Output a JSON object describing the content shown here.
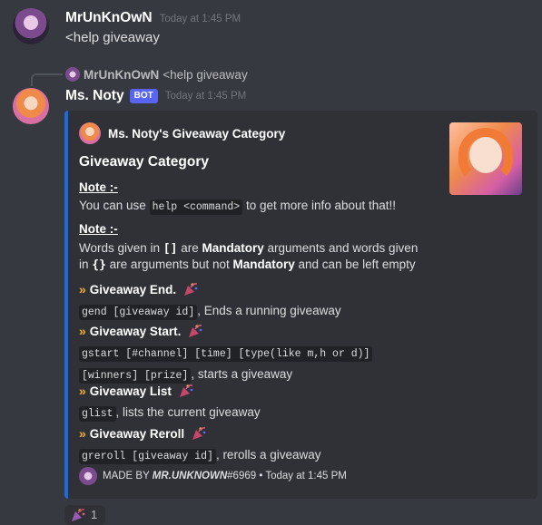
{
  "messages": [
    {
      "username": "MrUnKnOwN",
      "timestamp": "Today at 1:45 PM",
      "content": "<help giveaway"
    },
    {
      "reply": {
        "username": "MrUnKnOwN",
        "content": "<help giveaway"
      },
      "username": "Ms. Noty",
      "bot_tag": "BOT",
      "timestamp": "Today at 1:45 PM"
    }
  ],
  "embed": {
    "accent_color": "#1d6be0",
    "author": "Ms. Noty's Giveaway Category",
    "title": "Giveaway Category",
    "note1": {
      "heading": "Note :-",
      "text_before": "You can use ",
      "code": "help <command>",
      "text_after": " to get more info about that!!"
    },
    "note2": {
      "heading": "Note :-",
      "line1_a": "Words given in ",
      "line1_brackets": "[]",
      "line1_b": " are ",
      "line1_bold": "Mandatory",
      "line1_c": " arguments and words given",
      "line2_a": "in ",
      "line2_brackets": "{}",
      "line2_b": " are arguments but not ",
      "line2_bold": "Mandatory",
      "line2_c": " and can be left empty"
    },
    "commands": [
      {
        "title": "Giveaway End.",
        "code": "gend [giveaway id]",
        "desc": ", Ends a running giveaway"
      },
      {
        "title": "Giveaway Start.",
        "code": "gstart [#channel] [time] [type(like m,h or d)]",
        "code2": "[winners] [prize]",
        "desc": ", starts a giveaway"
      },
      {
        "title": "Giveaway List",
        "code": "glist",
        "desc": ", lists the current giveaway"
      },
      {
        "title": "Giveaway Reroll",
        "code": "greroll [giveaway id]",
        "desc": ", rerolls a giveaway"
      }
    ],
    "chevron": "»",
    "footer": {
      "made_by": "MADE BY ",
      "author_italic": "MR.UNKNOWN",
      "discriminator": "#6969",
      "separator": " • ",
      "timestamp": "Today at 1:45 PM"
    }
  },
  "reaction": {
    "emoji": "party-popper",
    "count": "1"
  }
}
